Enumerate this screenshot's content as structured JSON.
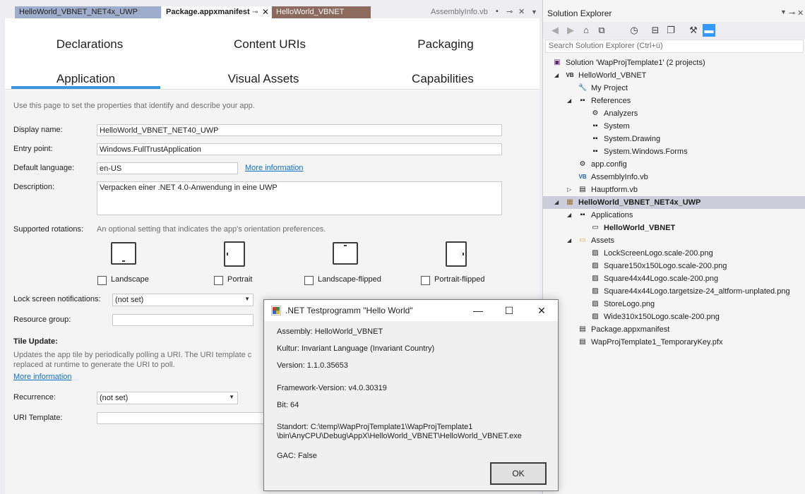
{
  "editor_tabs": [
    {
      "label": "HelloWorld_VBNET_NET4x_UWP"
    },
    {
      "label": "Package.appxmanifest"
    },
    {
      "label": "HelloWorld_VBNET"
    },
    {
      "label": "AssemblyInfo.vb"
    }
  ],
  "manifest": {
    "tabs_row1": [
      "Declarations",
      "Content URIs",
      "Packaging"
    ],
    "tabs_row2": [
      "Application",
      "Visual Assets",
      "Capabilities"
    ],
    "selected_tab": "Application",
    "intro": "Use this page to set the properties that identify and describe your app.",
    "display_name": {
      "label": "Display name:",
      "value": "HelloWorld_VBNET_NET40_UWP"
    },
    "entry_point": {
      "label": "Entry point:",
      "value": "Windows.FullTrustApplication"
    },
    "default_language": {
      "label": "Default language:",
      "value": "en-US",
      "link": "More information"
    },
    "description": {
      "label": "Description:",
      "value": "Verpacken einer .NET 4.0-Anwendung in eine UWP"
    },
    "rotations": {
      "label": "Supported rotations:",
      "hint": "An optional setting that indicates the app's orientation preferences.",
      "options": [
        "Landscape",
        "Portrait",
        "Landscape-flipped",
        "Portrait-flipped"
      ]
    },
    "lock_screen": {
      "label": "Lock screen notifications:",
      "value": "(not set)"
    },
    "resource_group": {
      "label": "Resource group:",
      "value": ""
    },
    "tile_update": {
      "heading": "Tile Update:",
      "desc_line1": "Updates the app tile by periodically polling a URI. The URI template c",
      "desc_line2": "replaced at runtime to generate the URI to poll.",
      "link": "More information",
      "recurrence_label": "Recurrence:",
      "recurrence_value": "(not set)",
      "uri_label": "URI Template:",
      "uri_value": ""
    }
  },
  "solution_explorer": {
    "title": "Solution Explorer",
    "search_placeholder": "Search Solution Explorer (Ctrl+ü)",
    "tree": [
      {
        "label": "Solution 'WapProjTemplate1' (2 projects)",
        "icon": "solution-icon"
      },
      {
        "label": "HelloWorld_VBNET",
        "icon": "vb-project-icon"
      },
      {
        "label": "My Project",
        "icon": "wrench-icon"
      },
      {
        "label": "References",
        "icon": "references-icon"
      },
      {
        "label": "Analyzers",
        "icon": "analyzers-icon"
      },
      {
        "label": "System",
        "icon": "reference-icon"
      },
      {
        "label": "System.Drawing",
        "icon": "reference-icon"
      },
      {
        "label": "System.Windows.Forms",
        "icon": "reference-icon"
      },
      {
        "label": "app.config",
        "icon": "config-icon"
      },
      {
        "label": "AssemblyInfo.vb",
        "icon": "vb-file-icon"
      },
      {
        "label": "Hauptform.vb",
        "icon": "form-icon"
      },
      {
        "label": "HelloWorld_VBNET_NET4x_UWP",
        "icon": "package-project-icon"
      },
      {
        "label": "Applications",
        "icon": "references-icon"
      },
      {
        "label": "HelloWorld_VBNET",
        "icon": "window-icon"
      },
      {
        "label": "Assets",
        "icon": "folder-icon"
      },
      {
        "label": "LockScreenLogo.scale-200.png",
        "icon": "image-icon"
      },
      {
        "label": "Square150x150Logo.scale-200.png",
        "icon": "image-icon"
      },
      {
        "label": "Square44x44Logo.scale-200.png",
        "icon": "image-icon"
      },
      {
        "label": "Square44x44Logo.targetsize-24_altform-unplated.png",
        "icon": "image-icon"
      },
      {
        "label": "StoreLogo.png",
        "icon": "image-icon"
      },
      {
        "label": "Wide310x150Logo.scale-200.png",
        "icon": "image-icon"
      },
      {
        "label": "Package.appxmanifest",
        "icon": "manifest-icon"
      },
      {
        "label": "WapProjTemplate1_TemporaryKey.pfx",
        "icon": "key-icon"
      }
    ]
  },
  "dialog": {
    "title": ".NET Testprogramm \"Hello World\"",
    "assembly": "Assembly: HelloWorld_VBNET",
    "kultur": "Kultur: Invariant Language (Invariant Country)",
    "version": "Version: 1.1.0.35653",
    "framework": "Framework-Version: v4.0.30319",
    "bit": "Bit: 64",
    "standort_line1": "Standort: C:\\temp\\WapProjTemplate1\\WapProjTemplate1",
    "standort_line2": "\\bin\\AnyCPU\\Debug\\AppX\\HelloWorld_VBNET\\HelloWorld_VBNET.exe",
    "gac": "GAC: False",
    "ok_label": "OK"
  }
}
